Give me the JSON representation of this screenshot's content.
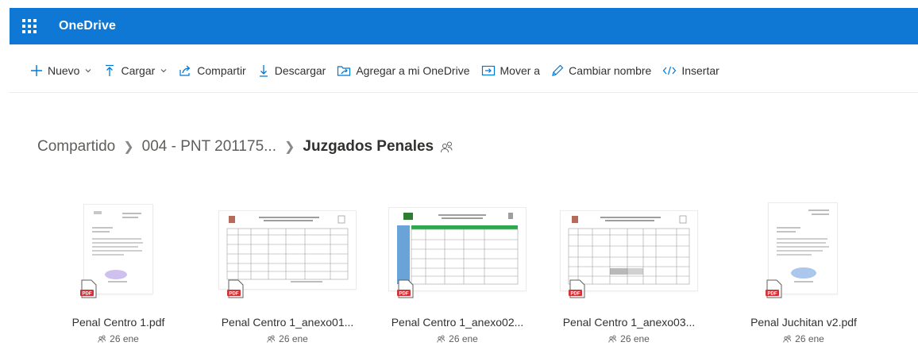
{
  "app": {
    "name": "OneDrive"
  },
  "toolbar": {
    "new_label": "Nuevo",
    "upload_label": "Cargar",
    "share_label": "Compartir",
    "download_label": "Descargar",
    "add_label": "Agregar a mi OneDrive",
    "move_label": "Mover a",
    "rename_label": "Cambiar nombre",
    "embed_label": "Insertar"
  },
  "breadcrumb": {
    "items": [
      "Compartido",
      "004 - PNT 201175...",
      "Juzgados Penales"
    ]
  },
  "files": [
    {
      "name": "Penal Centro 1.pdf",
      "date": "26 ene"
    },
    {
      "name": "Penal Centro 1_anexo01...",
      "date": "26 ene"
    },
    {
      "name": "Penal Centro 1_anexo02...",
      "date": "26 ene"
    },
    {
      "name": "Penal Centro 1_anexo03...",
      "date": "26 ene"
    },
    {
      "name": "Penal Juchitan v2.pdf",
      "date": "26 ene"
    }
  ],
  "colors": {
    "brand": "#0f78d4",
    "accent": "#0078d4",
    "pdf": "#d13438"
  }
}
